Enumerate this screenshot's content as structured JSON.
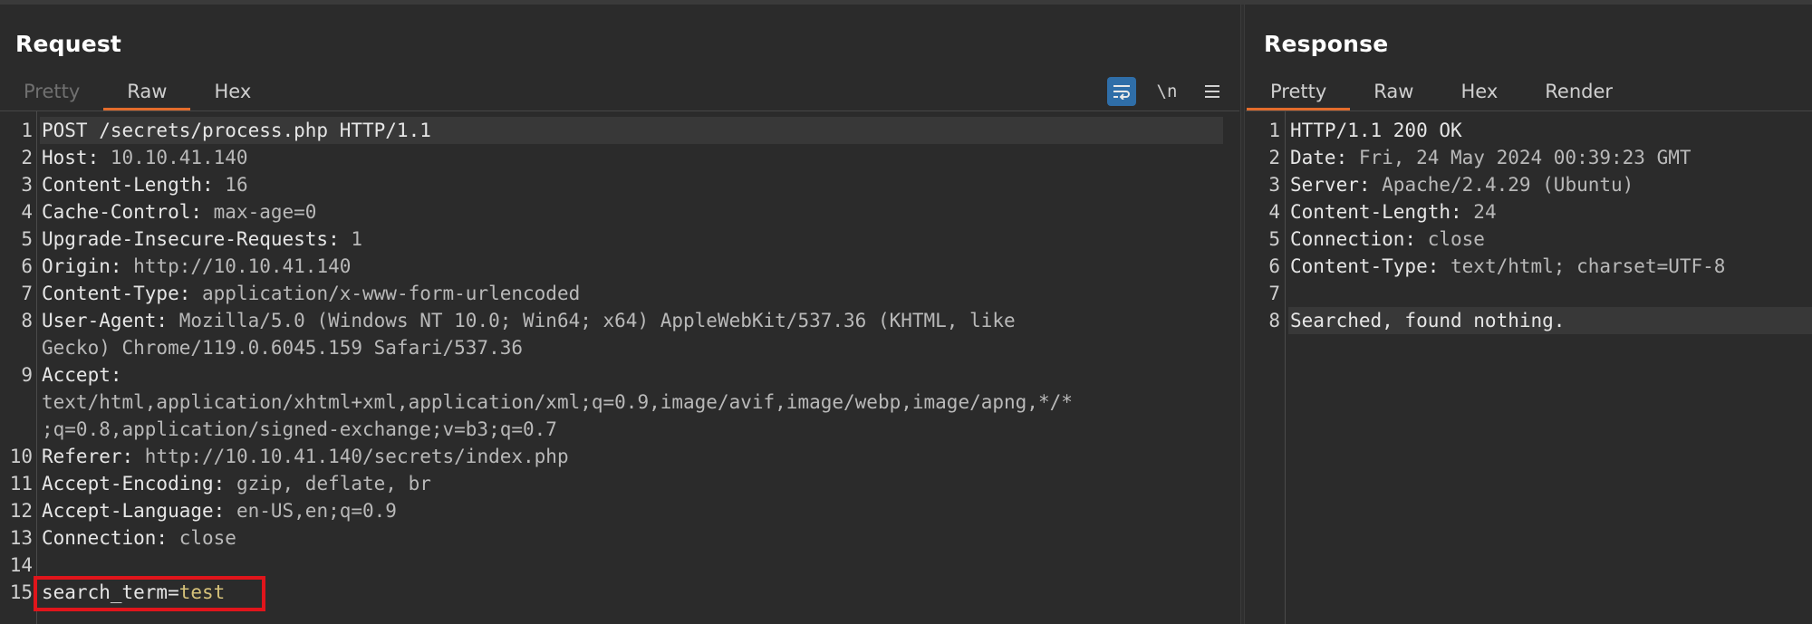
{
  "request": {
    "title": "Request",
    "tabs": [
      "Pretty",
      "Raw",
      "Hex"
    ],
    "active_tab": "Raw",
    "toolbar": {
      "wrap_icon": "word-wrap-icon",
      "newline_label": "\\n",
      "menu_icon": "hamburger-menu-icon"
    },
    "lines": [
      {
        "n": "1",
        "k": "POST /secrets/process.php HTTP/1.1",
        "v": ""
      },
      {
        "n": "2",
        "k": "Host:",
        "v": " 10.10.41.140"
      },
      {
        "n": "3",
        "k": "Content-Length:",
        "v": " 16"
      },
      {
        "n": "4",
        "k": "Cache-Control:",
        "v": " max-age=0"
      },
      {
        "n": "5",
        "k": "Upgrade-Insecure-Requests:",
        "v": " 1"
      },
      {
        "n": "6",
        "k": "Origin:",
        "v": " http://10.10.41.140"
      },
      {
        "n": "7",
        "k": "Content-Type:",
        "v": " application/x-www-form-urlencoded"
      },
      {
        "n": "8",
        "k": "User-Agent:",
        "v": " Mozilla/5.0 (Windows NT 10.0; Win64; x64) AppleWebKit/537.36 (KHTML, like"
      },
      {
        "n": "",
        "k": "",
        "v": "Gecko) Chrome/119.0.6045.159 Safari/537.36"
      },
      {
        "n": "9",
        "k": "Accept:",
        "v": ""
      },
      {
        "n": "",
        "k": "",
        "v": "text/html,application/xhtml+xml,application/xml;q=0.9,image/avif,image/webp,image/apng,*/*"
      },
      {
        "n": "",
        "k": "",
        "v": ";q=0.8,application/signed-exchange;v=b3;q=0.7"
      },
      {
        "n": "10",
        "k": "Referer:",
        "v": " http://10.10.41.140/secrets/index.php"
      },
      {
        "n": "11",
        "k": "Accept-Encoding:",
        "v": " gzip, deflate, br"
      },
      {
        "n": "12",
        "k": "Accept-Language:",
        "v": " en-US,en;q=0.9"
      },
      {
        "n": "13",
        "k": "Connection:",
        "v": " close"
      },
      {
        "n": "14",
        "k": "",
        "v": ""
      }
    ],
    "body_line": {
      "n": "15",
      "param": "search_term",
      "eq": "=",
      "value": "test"
    }
  },
  "response": {
    "title": "Response",
    "tabs": [
      "Pretty",
      "Raw",
      "Hex",
      "Render"
    ],
    "active_tab": "Pretty",
    "lines": [
      {
        "n": "1",
        "k": "HTTP/1.1 200 OK",
        "v": ""
      },
      {
        "n": "2",
        "k": "Date:",
        "v": " Fri, 24 May 2024 00:39:23 GMT"
      },
      {
        "n": "3",
        "k": "Server:",
        "v": " Apache/2.4.29 (Ubuntu)"
      },
      {
        "n": "4",
        "k": "Content-Length:",
        "v": " 24"
      },
      {
        "n": "5",
        "k": "Connection:",
        "v": " close"
      },
      {
        "n": "6",
        "k": "Content-Type:",
        "v": " text/html; charset=UTF-8"
      },
      {
        "n": "7",
        "k": "",
        "v": ""
      },
      {
        "n": "8",
        "k": "Searched, found nothing.",
        "v": ""
      }
    ]
  }
}
